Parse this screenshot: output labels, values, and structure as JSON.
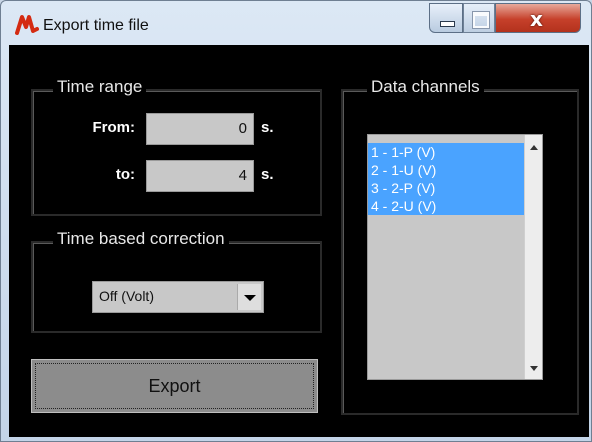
{
  "window": {
    "title": "Export time file",
    "icon": "app-logo-icon",
    "controls": [
      "minimize-icon",
      "maximize-icon",
      "close-icon"
    ]
  },
  "time_range": {
    "legend": "Time range",
    "from_label": "From:",
    "from_value": "0",
    "to_label": "to:",
    "to_value": "4",
    "unit": "s."
  },
  "correction": {
    "legend": "Time based correction",
    "selected": "Off (Volt)"
  },
  "export": {
    "label": "Export"
  },
  "channels": {
    "legend": "Data channels",
    "items": [
      {
        "label": "1 - 1-P (V)",
        "selected": true
      },
      {
        "label": "2 - 1-U (V)",
        "selected": true
      },
      {
        "label": "3 - 2-P (V)",
        "selected": true
      },
      {
        "label": "4 - 2-U (V)",
        "selected": true
      }
    ]
  },
  "colors": {
    "background": "#000000",
    "selection": "#4aa3ff",
    "field": "#c8c8c8"
  }
}
